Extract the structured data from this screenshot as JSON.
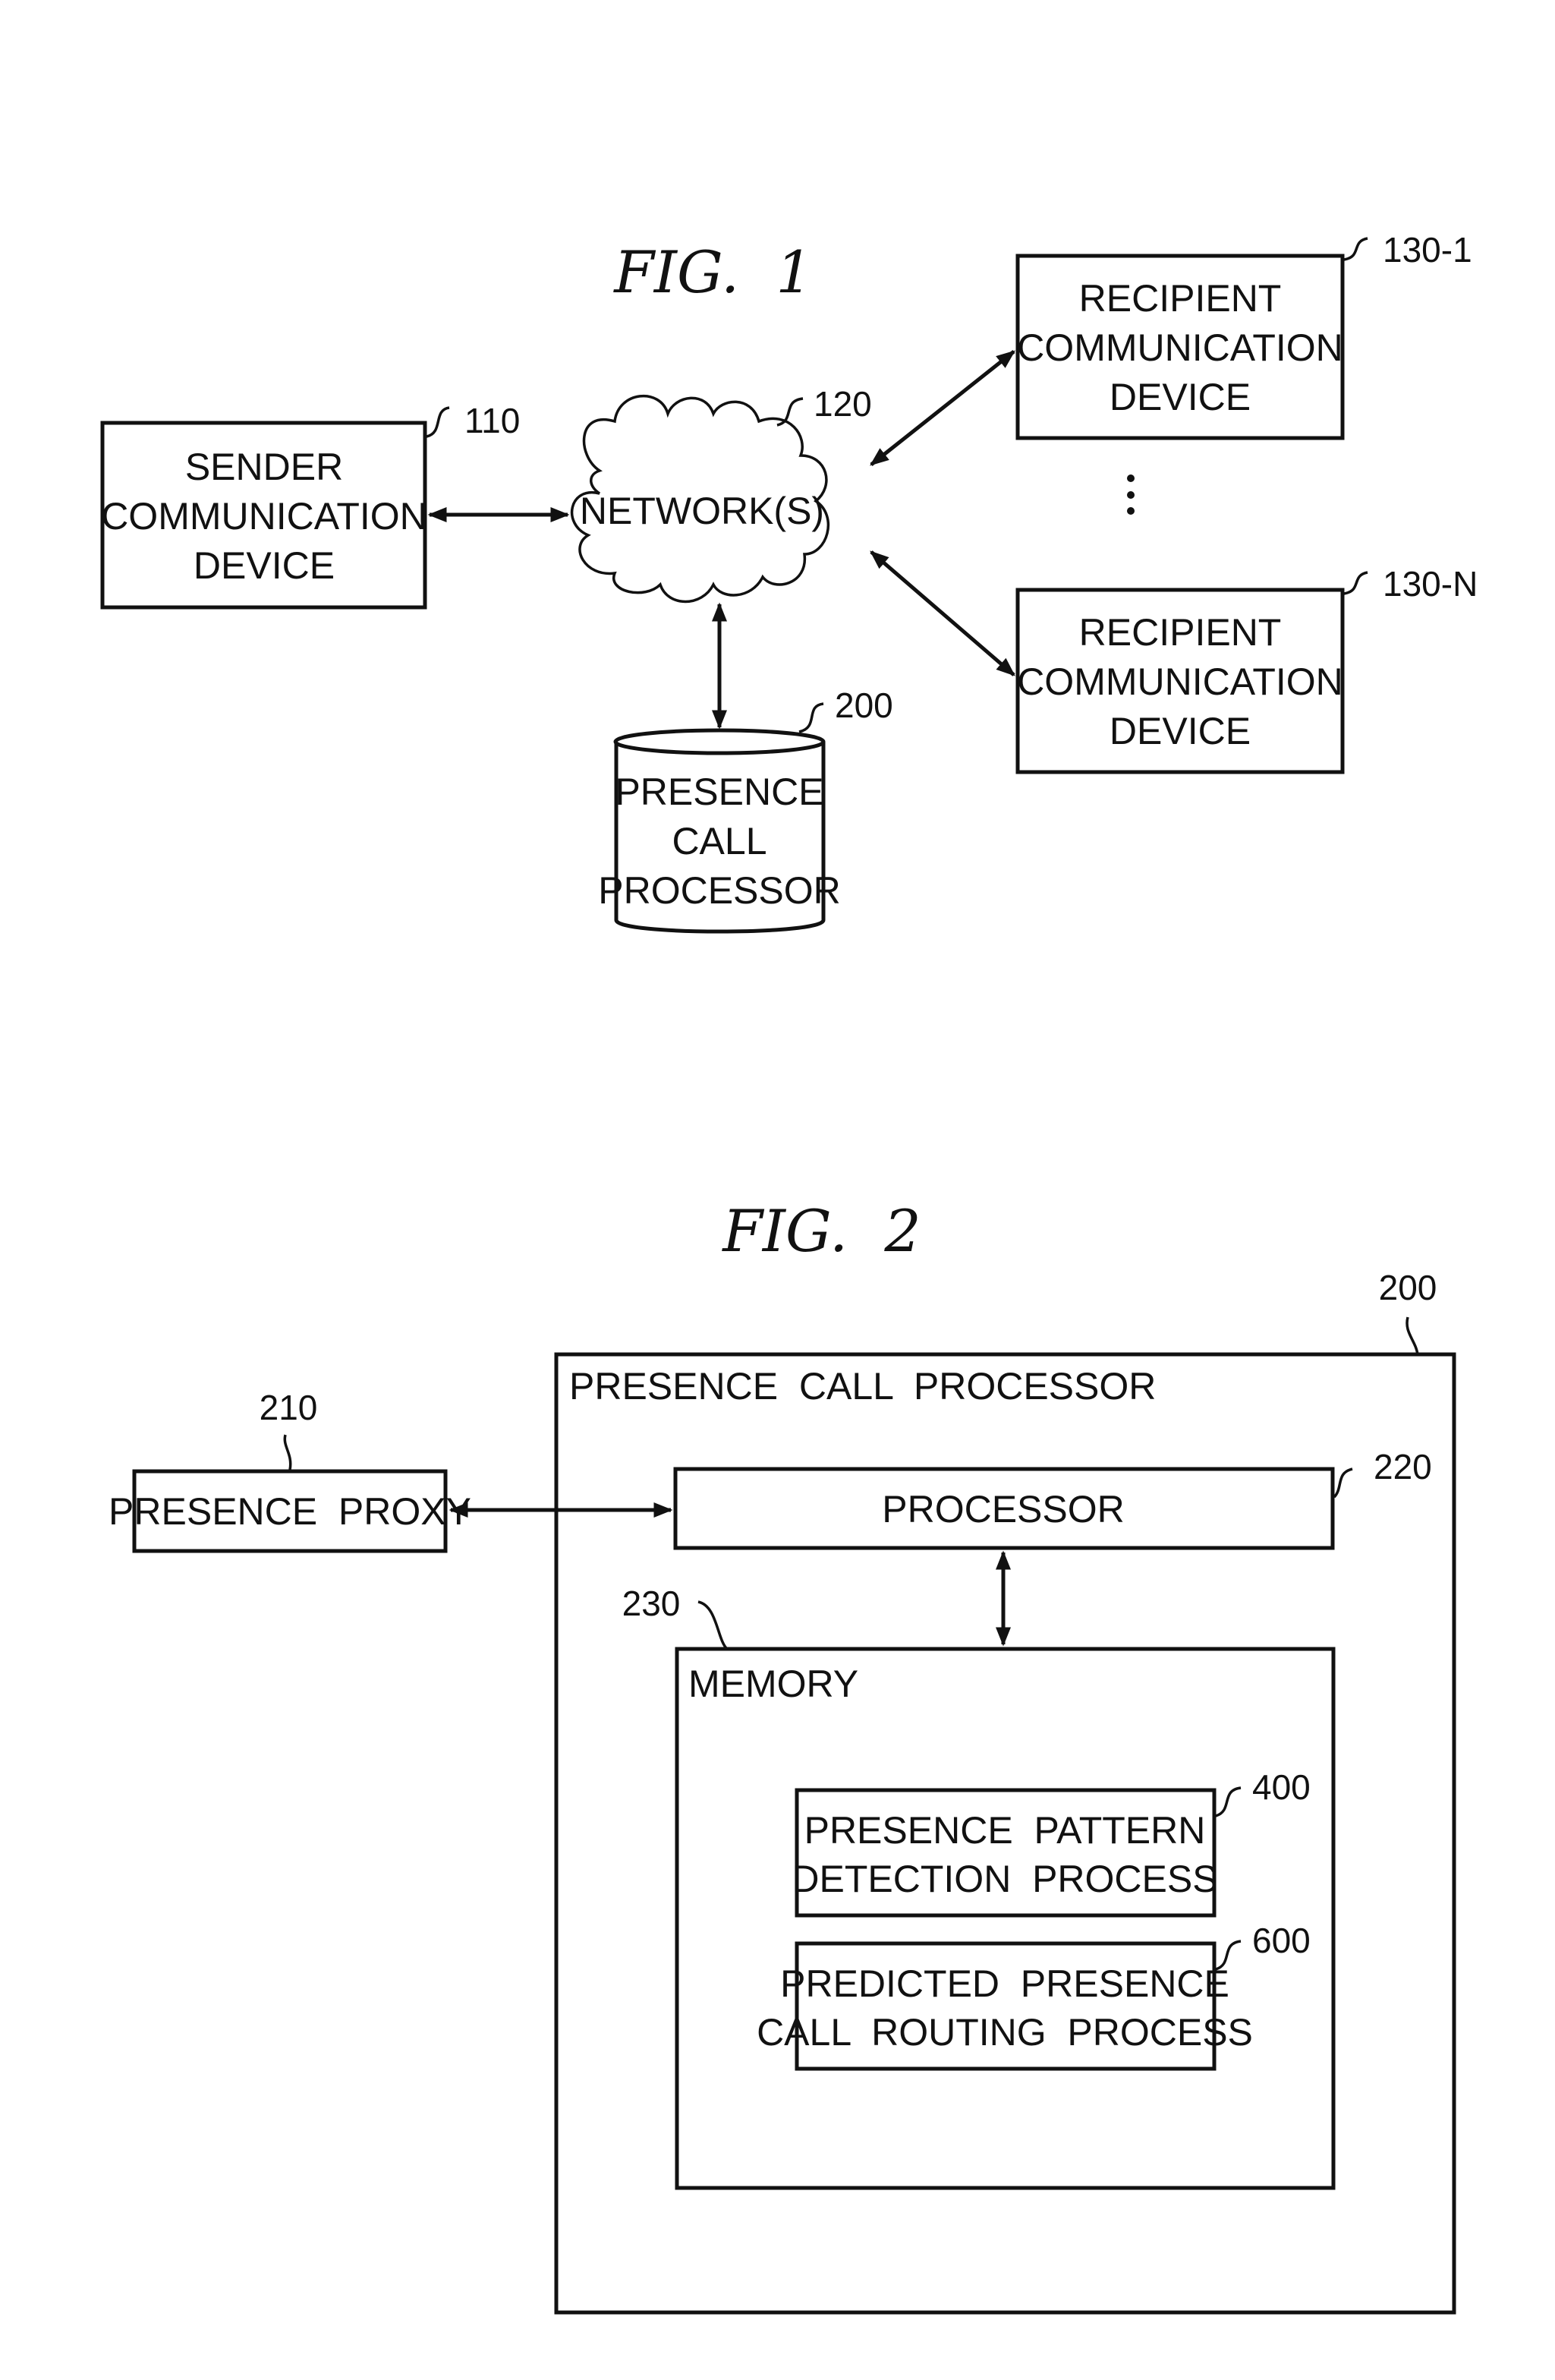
{
  "figures": [
    {
      "id": "fig1",
      "title": "FIG.  1",
      "nodes": {
        "sender": {
          "ref": "110",
          "lines": [
            "SENDER",
            "COMMUNICATION",
            "DEVICE"
          ]
        },
        "network": {
          "ref": "120",
          "lines": [
            "NETWORK(S)"
          ]
        },
        "recipient_1": {
          "ref": "130-1",
          "lines": [
            "RECIPIENT",
            "COMMUNICATION",
            "DEVICE"
          ]
        },
        "recipient_n": {
          "ref": "130-N",
          "lines": [
            "RECIPIENT",
            "COMMUNICATION",
            "DEVICE"
          ]
        },
        "presence_call_processor": {
          "ref": "200",
          "lines": [
            "PRESENCE",
            "CALL",
            "PROCESSOR"
          ]
        }
      },
      "ellipsis": "⋮",
      "edges": [
        {
          "from": "sender",
          "to": "network",
          "type": "bidirectional"
        },
        {
          "from": "network",
          "to": "recipient_1",
          "type": "bidirectional"
        },
        {
          "from": "network",
          "to": "recipient_n",
          "type": "bidirectional"
        },
        {
          "from": "network",
          "to": "presence_call_processor",
          "type": "bidirectional"
        }
      ]
    },
    {
      "id": "fig2",
      "title": "FIG.  2",
      "nodes": {
        "presence_proxy": {
          "ref": "210",
          "lines": [
            "PRESENCE  PROXY"
          ]
        },
        "presence_call_processor": {
          "ref": "200",
          "lines": [
            "PRESENCE  CALL  PROCESSOR"
          ]
        },
        "processor": {
          "ref": "220",
          "lines": [
            "PROCESSOR"
          ]
        },
        "memory": {
          "ref": "230",
          "lines": [
            "MEMORY"
          ]
        },
        "presence_pattern_detection": {
          "ref": "400",
          "lines": [
            "PRESENCE  PATTERN",
            "DETECTION  PROCESS"
          ]
        },
        "predicted_presence_routing": {
          "ref": "600",
          "lines": [
            "PREDICTED  PRESENCE",
            "CALL  ROUTING  PROCESS"
          ]
        }
      },
      "edges": [
        {
          "from": "presence_proxy",
          "to": "processor",
          "type": "bidirectional"
        },
        {
          "from": "processor",
          "to": "memory",
          "type": "bidirectional"
        }
      ]
    }
  ]
}
